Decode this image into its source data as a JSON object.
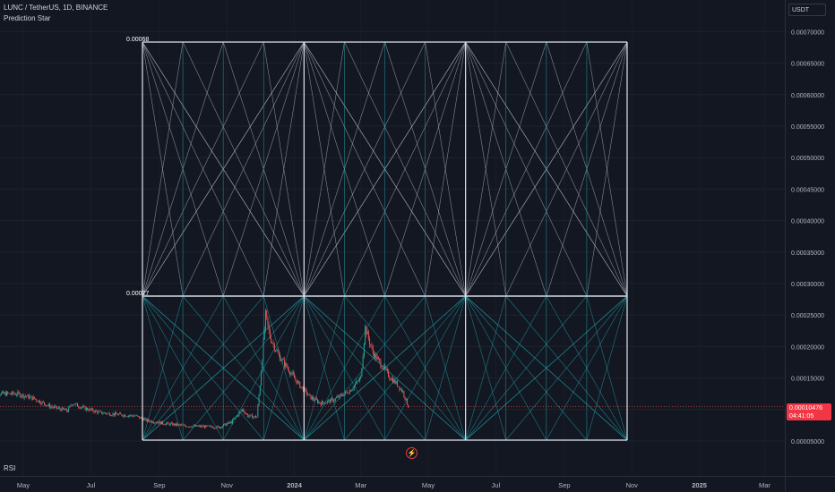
{
  "header": {
    "symbol": "LUNC / TetherUS, 1D, BINANCE",
    "indicator": "Prediction Star"
  },
  "currency_button": "USDT",
  "last_price": {
    "value": "0.00010476",
    "countdown": "04:41:05"
  },
  "rsi_label": "RSI",
  "colors": {
    "background": "#131722",
    "up": "#26a69a",
    "down": "#ef5350",
    "grid": "#2a2e39",
    "star_white": "#b2b5be",
    "star_cyan": "#1fa2a8"
  },
  "chart_data": {
    "type": "candlestick",
    "ylim": [
      5e-05,
      7.2e-05
    ],
    "y_ticks": [
      "0.00005000",
      "0.00010000",
      "0.00015000",
      "0.00020000",
      "0.00025000",
      "0.00030000",
      "0.00035000",
      "0.00040000",
      "0.00045000",
      "0.00050000",
      "0.00055000",
      "0.00060000",
      "0.00065000",
      "0.00070000"
    ],
    "x_ticks": [
      "May",
      "Jul",
      "Sep",
      "Nov",
      "2024",
      "Mar",
      "May",
      "Jul",
      "Sep",
      "Nov",
      "2025",
      "Mar"
    ],
    "star_labels": {
      "top": "0.00068",
      "mid": "0.00027"
    },
    "series": [
      {
        "values": [
          [
            "2023-04-25",
            0.000125
          ],
          [
            "2023-05-10",
            0.000118
          ],
          [
            "2023-05-25",
            0.000105
          ],
          [
            "2023-06-10",
            9.8e-05
          ],
          [
            "2023-06-14",
            0.00011
          ],
          [
            "2023-06-25",
            0.000102
          ],
          [
            "2023-07-10",
            9.5e-05
          ],
          [
            "2023-07-25",
            9.2e-05
          ],
          [
            "2023-08-10",
            9e-05
          ],
          [
            "2023-08-20",
            8.3e-05
          ],
          [
            "2023-09-05",
            7.8e-05
          ],
          [
            "2023-09-25",
            7.4e-05
          ],
          [
            "2023-10-10",
            7.3e-05
          ],
          [
            "2023-10-25",
            7.2e-05
          ],
          [
            "2023-11-05",
            8e-05
          ],
          [
            "2023-11-15",
            0.0001
          ],
          [
            "2023-11-20",
            9e-05
          ],
          [
            "2023-11-28",
            8.8e-05
          ],
          [
            "2023-12-01",
            0.00014
          ],
          [
            "2023-12-06",
            0.00025
          ],
          [
            "2023-12-10",
            0.000215
          ],
          [
            "2023-12-18",
            0.000185
          ],
          [
            "2023-12-28",
            0.00016
          ],
          [
            "2024-01-05",
            0.00014
          ],
          [
            "2024-01-15",
            0.00012
          ],
          [
            "2024-01-25",
            0.00011
          ],
          [
            "2024-02-05",
            0.000115
          ],
          [
            "2024-02-20",
            0.00013
          ],
          [
            "2024-03-01",
            0.00015
          ],
          [
            "2024-03-05",
            0.00023
          ],
          [
            "2024-03-12",
            0.00019
          ],
          [
            "2024-03-20",
            0.00017
          ],
          [
            "2024-03-28",
            0.00015
          ],
          [
            "2024-04-03",
            0.00014
          ],
          [
            "2024-04-08",
            0.000128
          ],
          [
            "2024-04-13",
            0.000105
          ]
        ]
      }
    ]
  }
}
